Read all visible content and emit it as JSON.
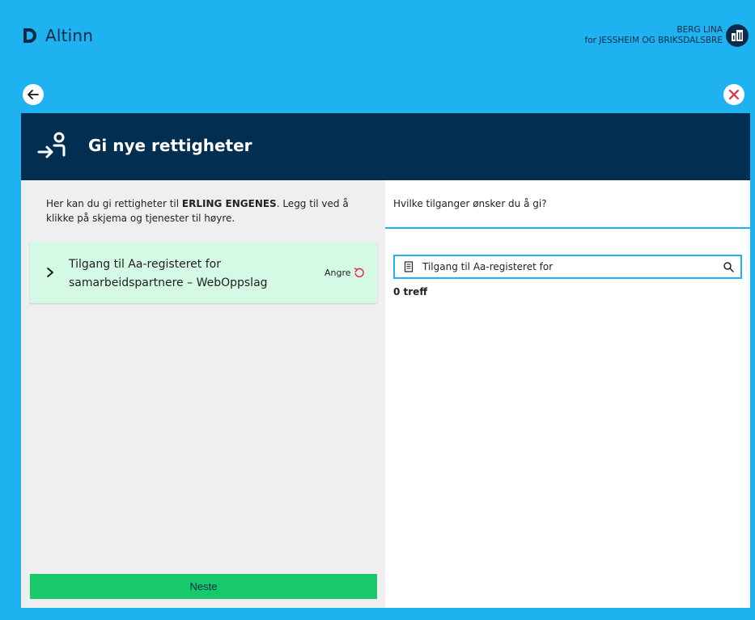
{
  "brand": {
    "name": "Altinn",
    "icon": "altinn-logo-icon"
  },
  "user": {
    "name": "BERG LINA",
    "org_line": "for JESSHEIM OG BRIKSDALSBRE",
    "avatar_icon": "building-icon"
  },
  "nav": {
    "back_icon": "arrow-left-icon",
    "close_icon": "close-icon"
  },
  "colors": {
    "background": "#1eb3f0",
    "header": "#022f51",
    "item_added": "#d4f9e4",
    "primary_button": "#17c96b",
    "close": "#e02e49"
  },
  "header": {
    "title": "Gi nye rettigheter",
    "icon": "person-arrow-icon"
  },
  "left": {
    "intro_prefix": "Her kan du gi rettigheter til ",
    "intro_name": "ERLING ENGENES",
    "intro_suffix": ". Legg til ved å klikke på skjema og tjenester til høyre.",
    "items": [
      {
        "title": "Tilgang til Aa-registeret for samarbeidspartnere – WebOppslag",
        "undo_label": "Angre",
        "chevron_icon": "chevron-right-icon",
        "undo_icon": "undo-icon"
      }
    ],
    "next_label": "Neste"
  },
  "right": {
    "question": "Hvilke tilganger ønsker du å gi?",
    "search_value": "Tilgang til Aa-registeret for",
    "search_doc_icon": "document-icon",
    "search_icon": "search-icon",
    "results_label": "0 treff"
  }
}
